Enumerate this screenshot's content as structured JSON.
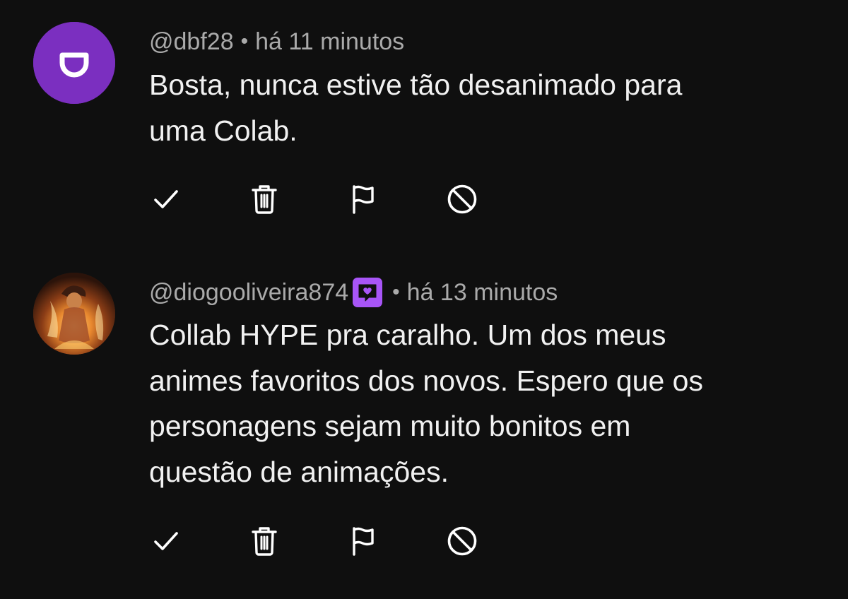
{
  "comments": [
    {
      "handle": "@dbf28",
      "separator": "•",
      "time": "há 11 minutos",
      "avatar_letter_icon": "d-letter-avatar",
      "avatar_color": "#7b2fc0",
      "text_lines": [
        "Bosta, nunca estive tão desanimado para",
        "uma Colab."
      ],
      "actions": [
        "approve-check-icon",
        "trash-icon",
        "flag-icon",
        "block-icon"
      ]
    },
    {
      "handle": "@diogooliveira874",
      "has_member_badge": true,
      "badge_icon": "member-heart-badge-icon",
      "badge_color": "#a855f7",
      "separator": "•",
      "time": "há 13 minutos",
      "text_lines": [
        "Collab HYPE pra caralho. Um dos meus",
        "animes favoritos dos novos. Espero que os",
        "personagens sejam muito bonitos em",
        "questão de animações."
      ],
      "actions": [
        "approve-check-icon",
        "trash-icon",
        "flag-icon",
        "block-icon"
      ]
    }
  ]
}
